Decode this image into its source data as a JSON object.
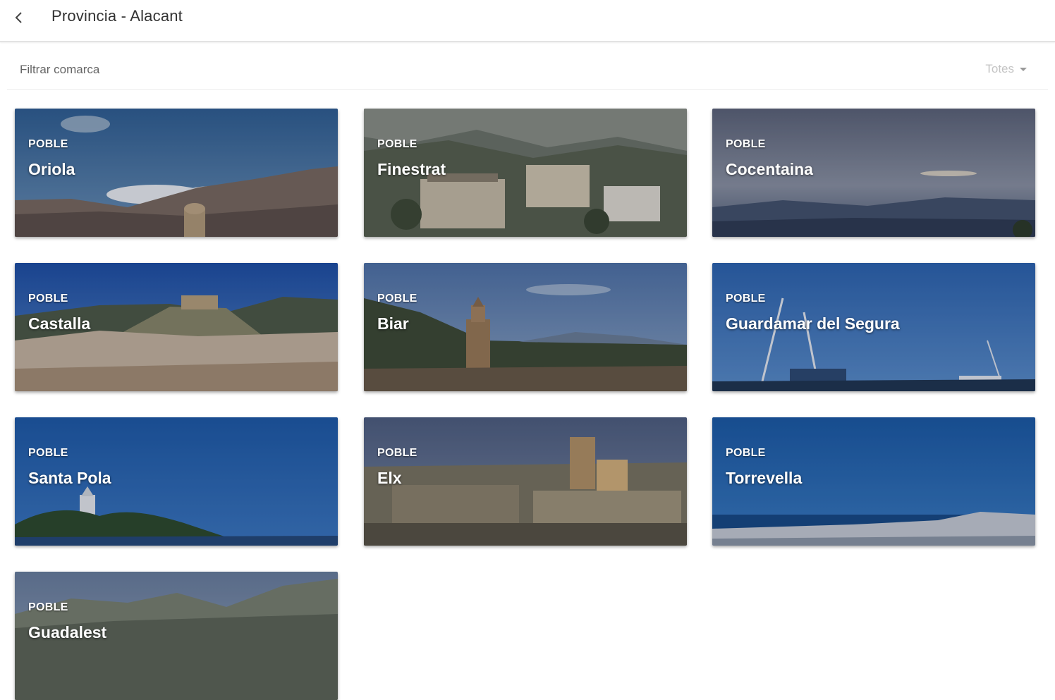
{
  "appbar": {
    "title": "Provincia - Alacant",
    "back_icon": "chevron-left-icon"
  },
  "filter": {
    "label": "Filtrar comarca",
    "value": "Totes",
    "dropdown_icon": "caret-down-icon"
  },
  "cards": [
    {
      "kind": "POBLE",
      "name": "Oriola"
    },
    {
      "kind": "POBLE",
      "name": "Finestrat"
    },
    {
      "kind": "POBLE",
      "name": "Cocentaina"
    },
    {
      "kind": "POBLE",
      "name": "Castalla"
    },
    {
      "kind": "POBLE",
      "name": "Biar"
    },
    {
      "kind": "POBLE",
      "name": "Guardamar del Segura"
    },
    {
      "kind": "POBLE",
      "name": "Santa Pola"
    },
    {
      "kind": "POBLE",
      "name": "Elx"
    },
    {
      "kind": "POBLE",
      "name": "Torrevella"
    },
    {
      "kind": "POBLE",
      "name": "Guadalest"
    }
  ]
}
